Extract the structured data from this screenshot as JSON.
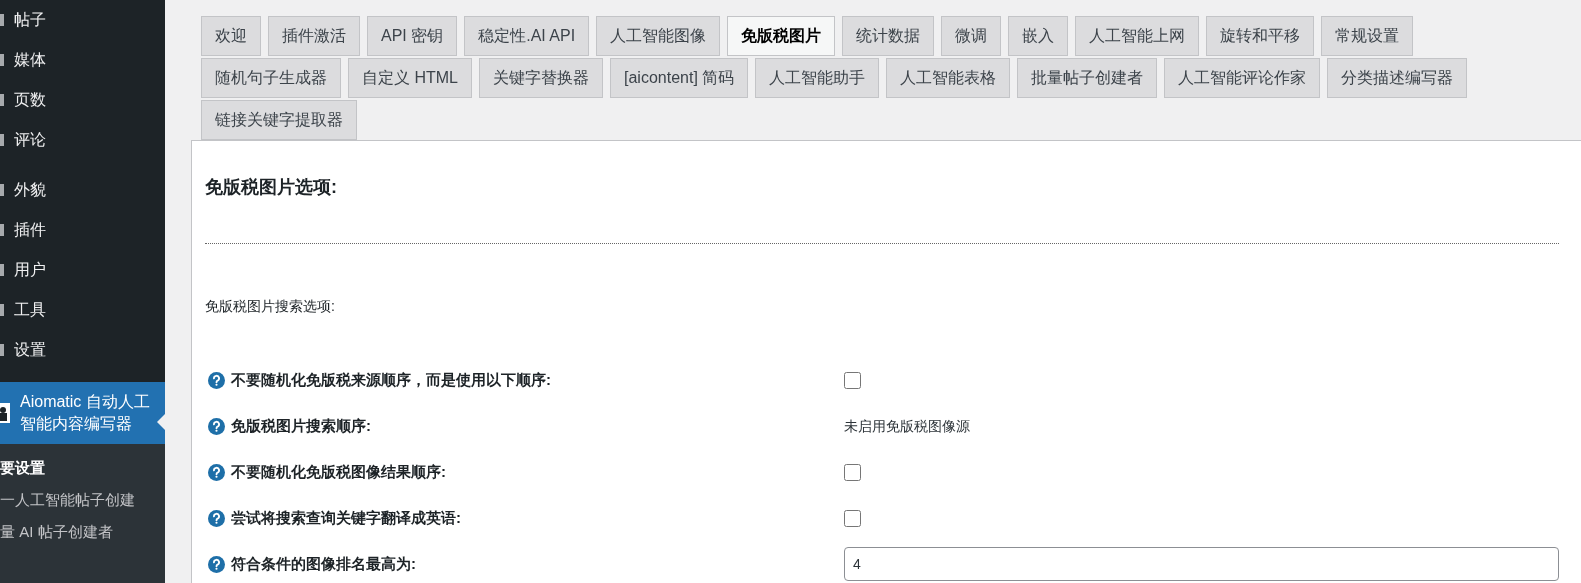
{
  "sidebar": {
    "items": [
      {
        "label": "帖子",
        "selected": false
      },
      {
        "label": "媒体",
        "selected": false
      },
      {
        "label": "页数",
        "selected": false
      },
      {
        "label": "评论",
        "selected": false
      },
      {
        "label": "外貌",
        "selected": false
      },
      {
        "label": "插件",
        "selected": false
      },
      {
        "label": "用户",
        "selected": false
      },
      {
        "label": "工具",
        "selected": false
      },
      {
        "label": "设置",
        "selected": false
      },
      {
        "label": "Aiomatic 自动人工智能内容编写器",
        "selected": true
      }
    ],
    "submenu": [
      {
        "label": "要设置",
        "selected": true
      },
      {
        "label": "一人工智能帖子创建",
        "selected": false
      },
      {
        "label": "量 AI 帖子创建者",
        "selected": false
      }
    ]
  },
  "tab_rows": [
    [
      {
        "label": "欢迎",
        "selected": false
      },
      {
        "label": "插件激活",
        "selected": false
      },
      {
        "label": "API 密钥",
        "selected": false
      },
      {
        "label": "稳定性.AI API",
        "selected": false
      },
      {
        "label": "人工智能图像",
        "selected": false
      },
      {
        "label": "免版税图片",
        "selected": true
      },
      {
        "label": "统计数据",
        "selected": false
      },
      {
        "label": "微调",
        "selected": false
      },
      {
        "label": "嵌入",
        "selected": false
      },
      {
        "label": "人工智能上网",
        "selected": false
      },
      {
        "label": "旋转和平移",
        "selected": false
      },
      {
        "label": "常规设置",
        "selected": false
      }
    ],
    [
      {
        "label": "随机句子生成器",
        "selected": false
      },
      {
        "label": "自定义 HTML",
        "selected": false
      },
      {
        "label": "关键字替换器",
        "selected": false
      },
      {
        "label": "[aicontent] 简码",
        "selected": false
      },
      {
        "label": "人工智能助手",
        "selected": false
      },
      {
        "label": "人工智能表格",
        "selected": false
      },
      {
        "label": "批量帖子创建者",
        "selected": false
      },
      {
        "label": "人工智能评论作家",
        "selected": false
      },
      {
        "label": "分类描述编写器",
        "selected": false
      }
    ],
    [
      {
        "label": "链接关键字提取器",
        "selected": false
      }
    ]
  ],
  "panel": {
    "heading": "免版税图片选项:",
    "section": "免版税图片搜索选项:",
    "options": [
      {
        "kind": "checkbox",
        "label": "不要随机化免版税来源顺序，而是使用以下顺序:",
        "checked": false
      },
      {
        "kind": "text",
        "label": "免版税图片搜索顺序:",
        "value": "未启用免版税图像源"
      },
      {
        "kind": "checkbox",
        "label": "不要随机化免版税图像结果顺序:",
        "checked": false
      },
      {
        "kind": "checkbox",
        "label": "尝试将搜索查询关键字翻译成英语:",
        "checked": false
      },
      {
        "kind": "input",
        "label": "符合条件的图像排名最高为:",
        "value": "4"
      }
    ]
  }
}
